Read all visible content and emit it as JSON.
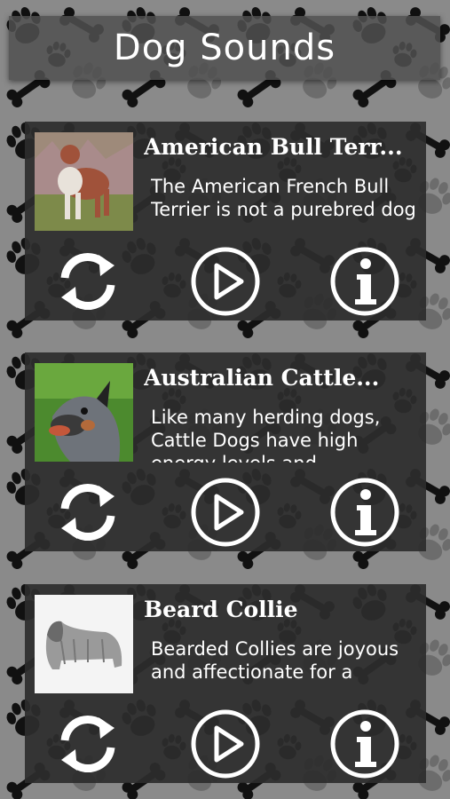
{
  "app": {
    "title": "Dog Sounds"
  },
  "colors": {
    "card_background": "#2c2c2c",
    "page_background": "#8a8a8a",
    "pattern": "#111111",
    "text": "#ffffff"
  },
  "cards": [
    {
      "title": "American Bull Terr...",
      "description": "The American French Bull Terrier is not a purebred dog",
      "image": "american-bull-terrier-photo"
    },
    {
      "title": "Australian Cattle...",
      "description": "Like many herding dogs, Cattle Dogs have high energy levels and",
      "image": "australian-cattle-dog-photo"
    },
    {
      "title": "Beard Collie",
      "description": "Bearded Collies are joyous and affectionate for a",
      "image": "bearded-collie-drawing"
    }
  ],
  "icons": {
    "refresh": "refresh-icon",
    "play": "play-icon",
    "info": "info-icon"
  }
}
